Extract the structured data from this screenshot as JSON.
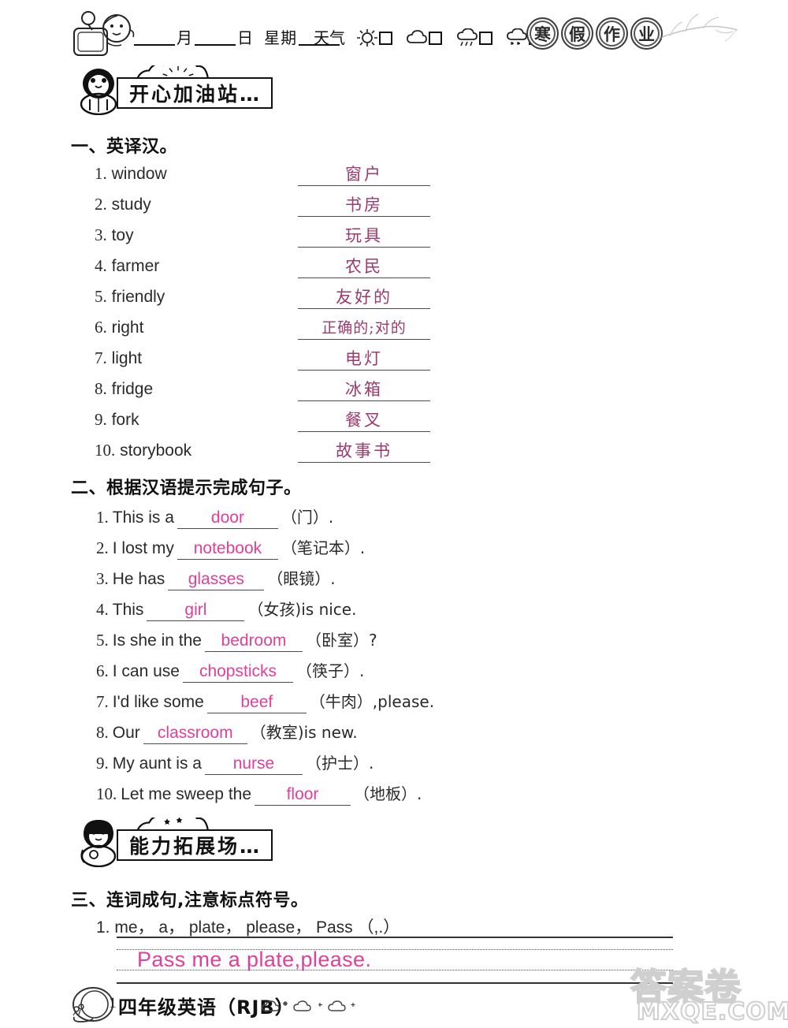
{
  "header": {
    "date_prefix_blank": "",
    "month_label": "月",
    "day_label": "日",
    "weekday_label": "星期",
    "weather_label": "天气",
    "weather_options": [
      {
        "icon": "sun-icon",
        "name": "sunny"
      },
      {
        "icon": "cloud-icon",
        "name": "cloudy"
      },
      {
        "icon": "rain-icon",
        "name": "rainy"
      },
      {
        "icon": "snow-icon",
        "name": "snowy"
      }
    ],
    "title_badges": [
      "寒",
      "假",
      "作",
      "业"
    ]
  },
  "banner1": {
    "text": "开心加油站…"
  },
  "banner2": {
    "text": "能力拓展场…"
  },
  "section1": {
    "title": "一、英译汉。",
    "items": [
      {
        "num": "1.",
        "word": "window",
        "answer": "窗户"
      },
      {
        "num": "2.",
        "word": "study",
        "answer": "书房"
      },
      {
        "num": "3.",
        "word": "toy",
        "answer": "玩具"
      },
      {
        "num": "4.",
        "word": "farmer",
        "answer": "农民"
      },
      {
        "num": "5.",
        "word": "friendly",
        "answer": "友好的"
      },
      {
        "num": "6.",
        "word": "right",
        "answer": "正确的;对的"
      },
      {
        "num": "7.",
        "word": "light",
        "answer": "电灯"
      },
      {
        "num": "8.",
        "word": "fridge",
        "answer": "冰箱"
      },
      {
        "num": "9.",
        "word": "fork",
        "answer": "餐叉"
      },
      {
        "num": "10.",
        "word": "storybook",
        "answer": "故事书"
      }
    ]
  },
  "section2": {
    "title": "二、根据汉语提示完成句子。",
    "items": [
      {
        "num": "1.",
        "before": "This is a",
        "answer": "door",
        "after": "（门）."
      },
      {
        "num": "2.",
        "before": "I lost my",
        "answer": "notebook",
        "after": "（笔记本）."
      },
      {
        "num": "3.",
        "before": "He has",
        "answer": "glasses",
        "after": "（眼镜）."
      },
      {
        "num": "4.",
        "before": "This",
        "answer": "girl",
        "after": "（女孩)is nice."
      },
      {
        "num": "5.",
        "before": "Is she in the",
        "answer": "bedroom",
        "after": "（卧室）?"
      },
      {
        "num": "6.",
        "before": "I can use",
        "answer": "chopsticks",
        "after": "（筷子）."
      },
      {
        "num": "7.",
        "before": "I'd like some",
        "answer": "beef",
        "after": "（牛肉）,please."
      },
      {
        "num": "8.",
        "before": "Our",
        "answer": "classroom",
        "after": "（教室)is new."
      },
      {
        "num": "9.",
        "before": "My aunt is a",
        "answer": "nurse",
        "after": "（护士）."
      },
      {
        "num": "10.",
        "before": "Let me sweep the",
        "answer": "floor",
        "after": "（地板）."
      }
    ]
  },
  "section3": {
    "title": "三、连词成句,注意标点符号。",
    "item_num": "1.",
    "words": "me，  a，  plate，  please，  Pass  （,.）",
    "answer": "Pass me a plate,please."
  },
  "footer": {
    "page_number": "1",
    "title": "四年级英语（RJB）"
  },
  "watermark": {
    "cn": "答案卷",
    "en": "MXQE.COM"
  },
  "colors": {
    "answer_cn": "#9b3a6e",
    "answer_en": "#e0409b",
    "ink": "#1a1a1a",
    "rule": "#4a4a4a"
  }
}
